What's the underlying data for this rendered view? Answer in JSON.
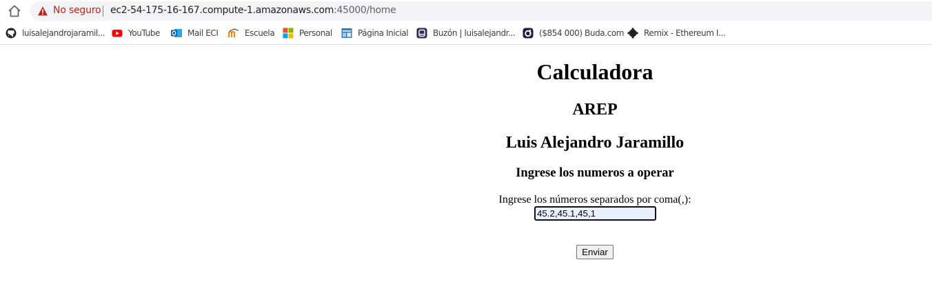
{
  "browser": {
    "security_label": "No seguro",
    "url_host": "ec2-54-175-16-167.compute-1.amazonaws.com",
    "url_path": ":45000/home",
    "warning_color": "#c5221f"
  },
  "bookmarks": [
    {
      "label": "luisalejandrojaramil...",
      "icon": "github-icon"
    },
    {
      "label": "YouTube",
      "icon": "youtube-icon"
    },
    {
      "label": "Mail ECI",
      "icon": "outlook-icon"
    },
    {
      "label": "Escuela",
      "icon": "moodle-icon"
    },
    {
      "label": "Personal",
      "icon": "microsoft-icon"
    },
    {
      "label": "Página Inicial",
      "icon": "portal-icon"
    },
    {
      "label": "Buzón | luisalejandr...",
      "icon": "mailbox-icon"
    },
    {
      "label": "($854 000) Buda.com",
      "icon": "buda-icon"
    },
    {
      "label": "Remix - Ethereum I...",
      "icon": "remix-icon"
    }
  ],
  "page": {
    "title": "Calculadora",
    "subtitle": "AREP",
    "author": "Luis Alejandro Jaramillo",
    "prompt_heading": "Ingrese los numeros a operar",
    "input_label": "Ingrese los números separados por coma(,):",
    "input_value": "45.2,45.1,45,1",
    "submit_label": "Enviar"
  }
}
